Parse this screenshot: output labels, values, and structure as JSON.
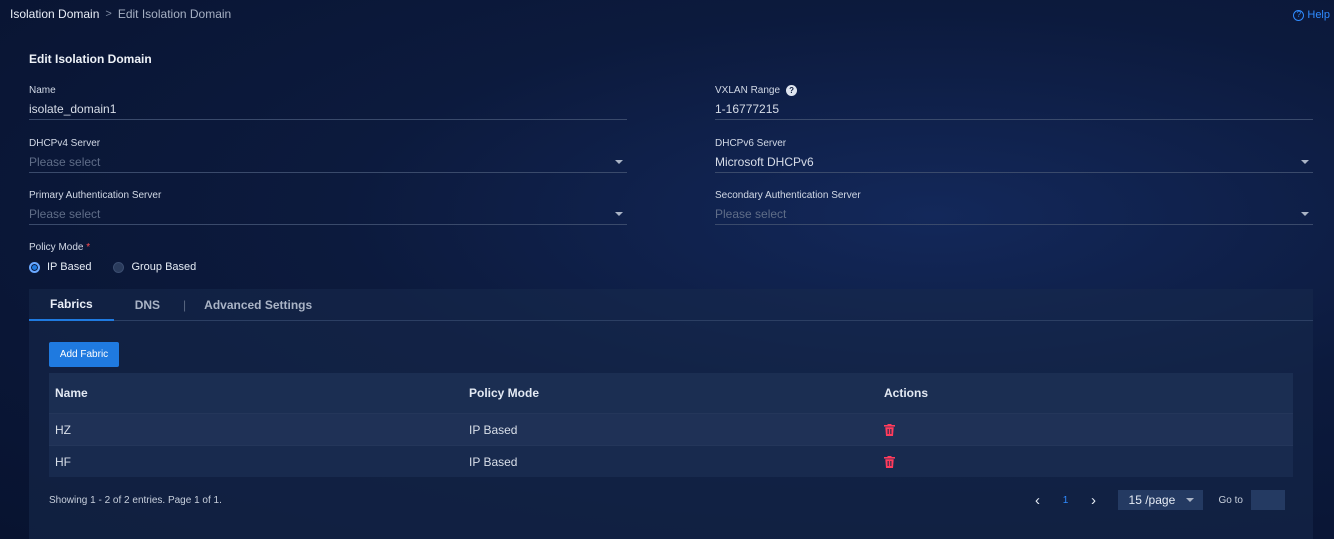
{
  "breadcrumb": {
    "root": "Isolation Domain",
    "separator": ">",
    "current": "Edit Isolation Domain"
  },
  "help_label": "Help",
  "section_title": "Edit Isolation Domain",
  "form": {
    "name": {
      "label": "Name",
      "value": "isolate_domain1"
    },
    "vxlan": {
      "label": "VXLAN Range",
      "value": "1-16777215"
    },
    "dhcpv4": {
      "label": "DHCPv4 Server",
      "placeholder": "Please select"
    },
    "dhcpv6": {
      "label": "DHCPv6 Server",
      "value": "Microsoft DHCPv6"
    },
    "primary_auth": {
      "label": "Primary Authentication Server",
      "placeholder": "Please select"
    },
    "secondary_auth": {
      "label": "Secondary Authentication Server",
      "placeholder": "Please select"
    },
    "policy_mode": {
      "label": "Policy Mode",
      "required_mark": "*",
      "options": [
        "IP Based",
        "Group Based"
      ],
      "selected": "IP Based"
    }
  },
  "tabs": [
    "Fabrics",
    "DNS",
    "Advanced Settings"
  ],
  "active_tab": "Fabrics",
  "add_button": "Add Fabric",
  "table": {
    "columns": [
      "Name",
      "Policy Mode",
      "Actions"
    ],
    "rows": [
      {
        "name": "HZ",
        "policy_mode": "IP Based"
      },
      {
        "name": "HF",
        "policy_mode": "IP Based"
      }
    ]
  },
  "footer": {
    "summary": "Showing 1 - 2 of 2 entries. Page 1 of 1.",
    "current_page": "1",
    "page_size": "15 /page",
    "goto_label": "Go to"
  },
  "colors": {
    "accent": "#1f7ae0",
    "danger": "#ff3b5c",
    "link": "#2f8bff"
  }
}
